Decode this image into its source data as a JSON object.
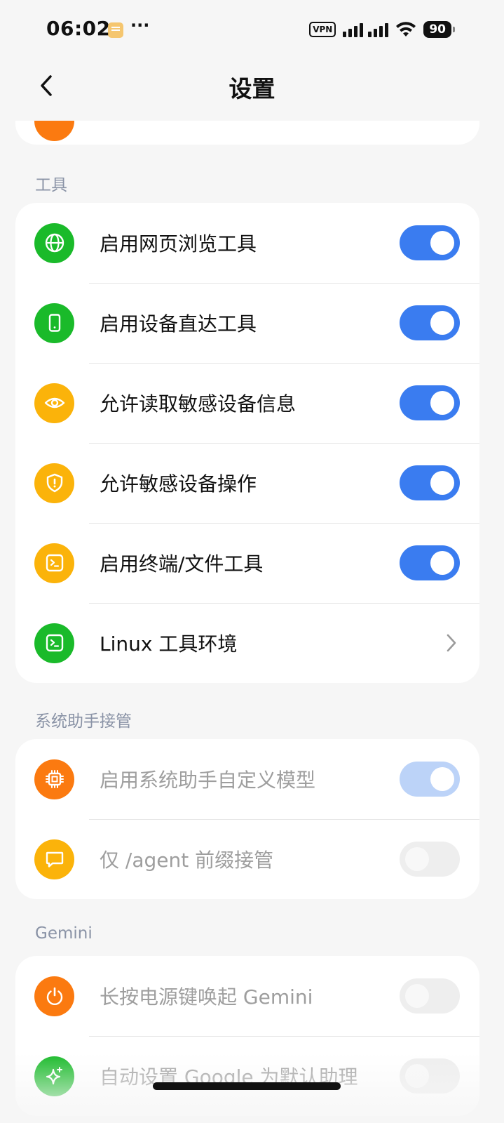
{
  "status_bar": {
    "time": "06:02",
    "more": "···",
    "vpn": "VPN",
    "battery": "90"
  },
  "header": {
    "title": "设置"
  },
  "colors": {
    "toggle_on": "#3a7cf0",
    "toggle_on_disabled": "#bcd3f8",
    "toggle_off": "#eeeeee",
    "icon_green": "#1aba2a",
    "icon_yellow": "#fbb30a",
    "icon_orange": "#fb7a10"
  },
  "top_card": {
    "partial_icon_color": "#fb7a10"
  },
  "sections": [
    {
      "label": "工具",
      "items": [
        {
          "label": "启用网页浏览工具",
          "icon": "globe-icon",
          "icon_color": "#1aba2a",
          "control": "toggle",
          "state": "on"
        },
        {
          "label": "启用设备直达工具",
          "icon": "phone-icon",
          "icon_color": "#1aba2a",
          "control": "toggle",
          "state": "on"
        },
        {
          "label": "允许读取敏感设备信息",
          "icon": "eye-icon",
          "icon_color": "#fbb30a",
          "control": "toggle",
          "state": "on"
        },
        {
          "label": "允许敏感设备操作",
          "icon": "shield-alert-icon",
          "icon_color": "#fbb30a",
          "control": "toggle",
          "state": "on"
        },
        {
          "label": "启用终端/文件工具",
          "icon": "terminal-icon",
          "icon_color": "#fbb30a",
          "control": "toggle",
          "state": "on"
        },
        {
          "label": "Linux 工具环境",
          "icon": "terminal-icon",
          "icon_color": "#1aba2a",
          "control": "chevron",
          "state": ""
        }
      ]
    },
    {
      "label": "系统助手接管",
      "items": [
        {
          "label": "启用系统助手自定义模型",
          "icon": "chip-icon",
          "icon_color": "#fb7a10",
          "control": "toggle",
          "state": "on-disabled"
        },
        {
          "label": "仅 /agent 前缀接管",
          "icon": "chat-bubble-icon",
          "icon_color": "#fbb30a",
          "control": "toggle",
          "state": "off"
        }
      ]
    },
    {
      "label": "Gemini",
      "items": [
        {
          "label": "长按电源键唤起 Gemini",
          "icon": "power-icon",
          "icon_color": "#fb7a10",
          "control": "toggle",
          "state": "off"
        },
        {
          "label": "自动设置 Google 为默认助理",
          "icon": "sparkle-icon",
          "icon_color": "#1aba2a",
          "control": "toggle",
          "state": "off"
        }
      ]
    }
  ]
}
